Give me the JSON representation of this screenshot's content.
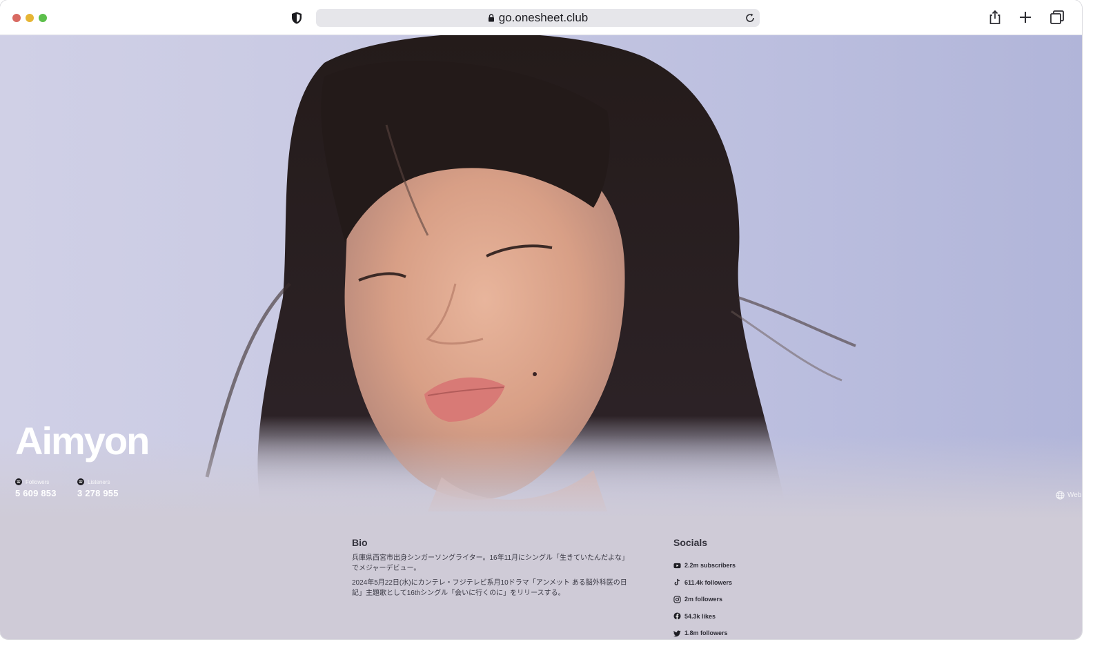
{
  "browser": {
    "url": "go.onesheet.club"
  },
  "artist": {
    "name": "Aimyon",
    "stats": [
      {
        "label": "Followers",
        "value": "5 609 853",
        "icon": "spotify-icon"
      },
      {
        "label": "Listeners",
        "value": "3 278 955",
        "icon": "spotify-icon"
      }
    ],
    "website_label": "Web"
  },
  "bio": {
    "title": "Bio",
    "paragraphs": [
      "兵庫県西宮市出身シンガーソングライター。16年11月にシングル「生きていたんだよな」でメジャーデビュー。",
      "2024年5月22日(水)にカンテレ・フジテレビ系月10ドラマ「アンメット ある脳外科医の日記」主題歌として16thシングル「会いに行くのに」をリリースする。"
    ]
  },
  "socials": {
    "title": "Socials",
    "items": [
      {
        "icon": "youtube-icon",
        "text": "2.2m subscribers"
      },
      {
        "icon": "tiktok-icon",
        "text": "611.4k followers"
      },
      {
        "icon": "instagram-icon",
        "text": "2m followers"
      },
      {
        "icon": "facebook-icon",
        "text": "54.3k likes"
      },
      {
        "icon": "twitter-icon",
        "text": "1.8m followers"
      }
    ]
  },
  "colors": {
    "hero_bg": "#c8c9e3",
    "content_bg": "#cfcbd7",
    "traffic_close": "#d86a62",
    "traffic_min": "#e6b534",
    "traffic_max": "#5cbf4b"
  }
}
